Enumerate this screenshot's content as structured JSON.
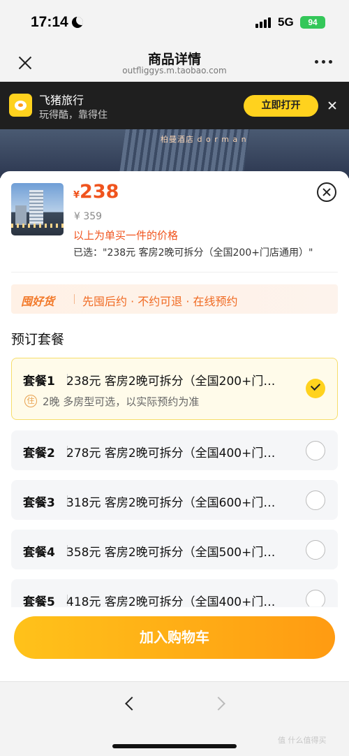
{
  "status_bar": {
    "time": "17:14",
    "network": "5G",
    "battery": "94"
  },
  "nav": {
    "title": "商品详情",
    "url": "outfliggys.m.taobao.com"
  },
  "app_banner": {
    "name": "飞猪旅行",
    "slogan": "玩得酷，靠得住",
    "open_label": "立即打开"
  },
  "hero": {
    "sign_text": "柏曼酒店 d o r m a n"
  },
  "product": {
    "currency": "¥",
    "price": "238",
    "original_price": "¥ 359",
    "price_note": "以上为单买一件的价格",
    "selected": "已选：\"238元 客房2晚可拆分（全国200+门店通用）\""
  },
  "guarantee": {
    "logo": "囤好货",
    "text": "先囤后约 · 不约可退 · 在线预约"
  },
  "section_title": "预订套餐",
  "packages": [
    {
      "name": "套餐1",
      "desc": "238元 客房2晚可拆分（全国200+门…",
      "selected": true,
      "sub_icon": "住",
      "sub": "2晚 多房型可选，以实际预约为准"
    },
    {
      "name": "套餐2",
      "desc": "278元 客房2晚可拆分（全国400+门…",
      "selected": false
    },
    {
      "name": "套餐3",
      "desc": "318元 客房2晚可拆分（全国600+门…",
      "selected": false
    },
    {
      "name": "套餐4",
      "desc": "358元 客房2晚可拆分（全国500+门…",
      "selected": false
    },
    {
      "name": "套餐5",
      "desc": "418元 客房2晚可拆分（全国400+门…",
      "selected": false
    }
  ],
  "cta": {
    "label": "加入购物车"
  },
  "watermark": "值 什么值得买",
  "colors": {
    "accent": "#f0541e",
    "brand_yellow": "#ffd21e",
    "cta_start": "#ffc21a",
    "cta_end": "#ff9b12"
  },
  "icons": [
    "moon-icon",
    "signal-icon",
    "battery-icon",
    "close-icon",
    "more-icon",
    "app-logo-icon",
    "banner-close-icon",
    "sheet-close-icon",
    "check-icon",
    "back-icon",
    "forward-icon"
  ]
}
